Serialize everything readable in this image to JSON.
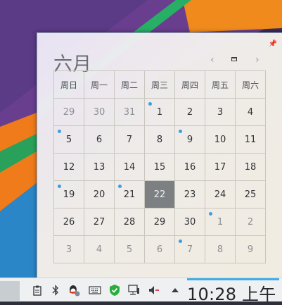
{
  "calendar": {
    "month_title": "六月",
    "nav_prev": "‹",
    "nav_next": "›",
    "weekdays": [
      "周日",
      "周一",
      "周二",
      "周三",
      "周四",
      "周五",
      "周六"
    ],
    "weeks": [
      [
        "29",
        "30",
        "31",
        "1",
        "2",
        "3",
        "4"
      ],
      [
        "5",
        "6",
        "7",
        "8",
        "9",
        "10",
        "11"
      ],
      [
        "12",
        "13",
        "14",
        "15",
        "16",
        "17",
        "18"
      ],
      [
        "19",
        "20",
        "21",
        "22",
        "23",
        "24",
        "25"
      ],
      [
        "26",
        "27",
        "28",
        "29",
        "30",
        "1",
        "2"
      ],
      [
        "3",
        "4",
        "5",
        "6",
        "7",
        "8",
        "9"
      ]
    ],
    "today": "22",
    "accent_color": "#3daee9",
    "event_dot_color": "#3d9ee0"
  },
  "taskbar": {
    "clock_time": "10:28 上午",
    "icons": [
      "clipboard-icon",
      "bluetooth-icon",
      "qq-icon",
      "keyboard-icon",
      "shield-check-icon",
      "network-icon",
      "volume-muted-icon",
      "tray-expand-icon"
    ]
  }
}
